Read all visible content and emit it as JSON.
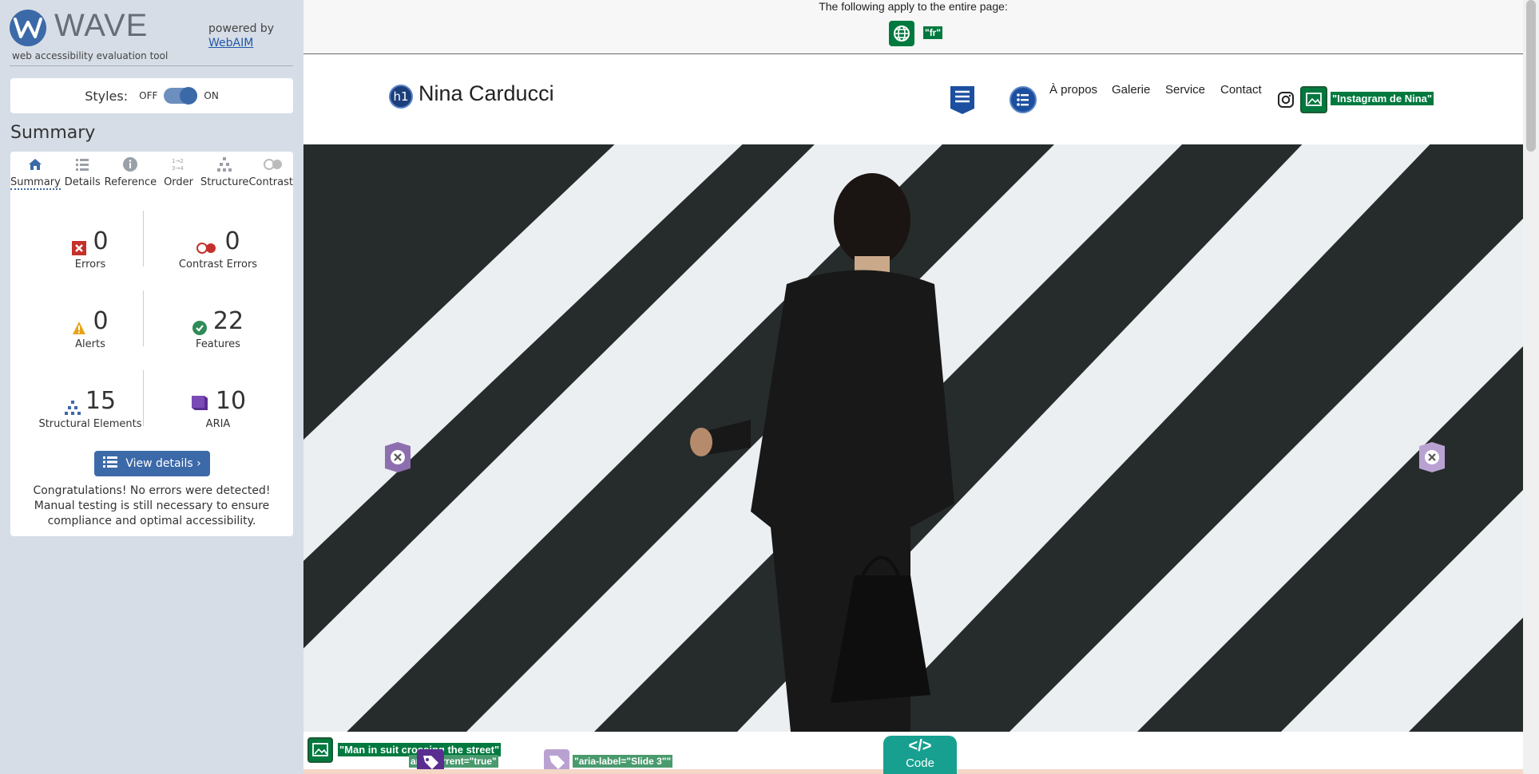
{
  "sidebar": {
    "logo_text": "WAVE",
    "logo_sub": "web accessibility evaluation tool",
    "powered_by": "powered by",
    "powered_link": "WebAIM",
    "styles_label": "Styles:",
    "styles_off": "OFF",
    "styles_on": "ON",
    "summary_title": "Summary",
    "tabs": [
      {
        "label": "Summary",
        "icon": "home-icon"
      },
      {
        "label": "Details",
        "icon": "list-icon"
      },
      {
        "label": "Reference",
        "icon": "info-icon"
      },
      {
        "label": "Order",
        "icon": "order-icon"
      },
      {
        "label": "Structure",
        "icon": "structure-icon"
      },
      {
        "label": "Contrast",
        "icon": "contrast-icon"
      }
    ],
    "stats": {
      "errors": {
        "value": "0",
        "label": "Errors"
      },
      "contrast": {
        "value": "0",
        "label": "Contrast Errors"
      },
      "alerts": {
        "value": "0",
        "label": "Alerts"
      },
      "features": {
        "value": "22",
        "label": "Features"
      },
      "structural": {
        "value": "15",
        "label": "Structural Elements"
      },
      "aria": {
        "value": "10",
        "label": "ARIA"
      }
    },
    "view_details": "View details ›",
    "congrats": "Congratulations! No errors were detected! Manual testing is still necessary to ensure compliance and optimal accessibility."
  },
  "pagebar": {
    "text": "The following apply to the entire page:",
    "lang_label": "\"fr\""
  },
  "site": {
    "h1_badge": "h1",
    "title": "Nina Carducci",
    "nav": [
      "À propos",
      "Galerie",
      "Service",
      "Contact"
    ],
    "instagram_label": "\"Instagram de Nina\""
  },
  "hero": {
    "alt_label": "\"Man in suit crossing the street\"",
    "aria_current": "aria-current=\"true\"",
    "aria_label_slide3": "\"aria-label=\"Slide 3\"\""
  },
  "code_tab": {
    "label": "Code"
  },
  "colors": {
    "wave_blue": "#3c69a8",
    "feature_green": "#00793f",
    "aria_purple": "#5a2d91",
    "error_red": "#c4302b",
    "alert_orange": "#e8a317"
  }
}
